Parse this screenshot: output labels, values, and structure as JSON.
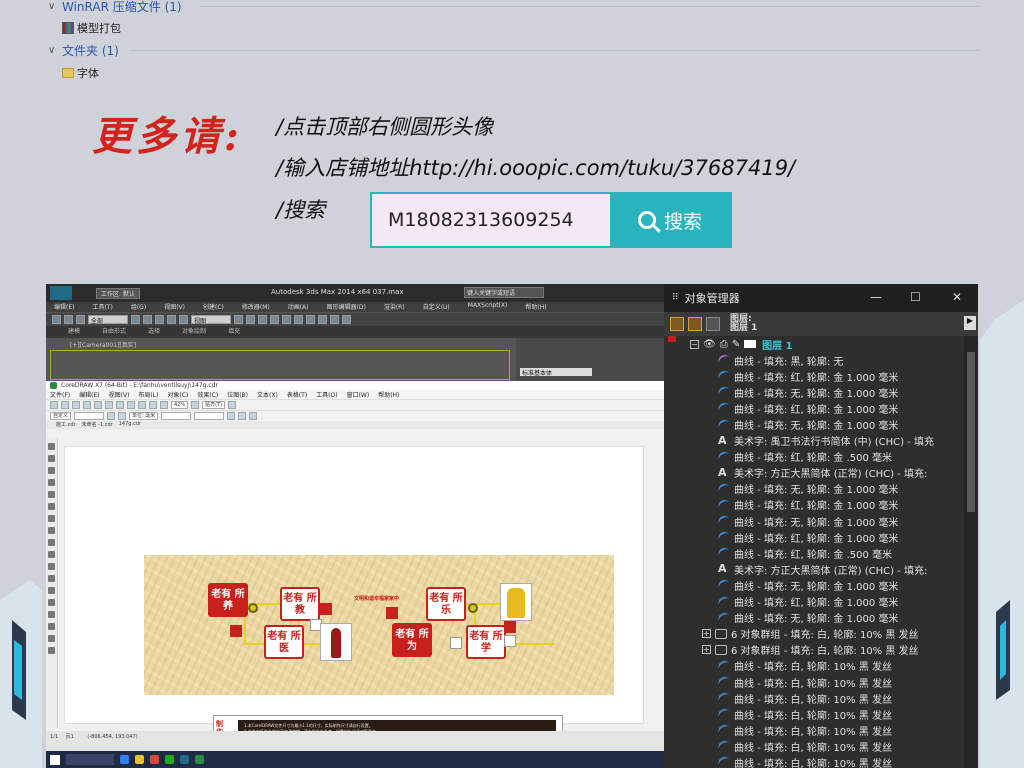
{
  "explorer": {
    "groups": [
      {
        "label": "WinRAR 压缩文件 (1)",
        "file": "模型打包"
      },
      {
        "label": "文件夹 (1)",
        "file": "字体"
      }
    ]
  },
  "promo": {
    "headline": "更多请:",
    "line1": "/点击顶部右侧圆形头像",
    "line2": "/输入店铺地址http://hi.ooopic.com/tuku/37687419/",
    "line3": "/搜索",
    "search_value": "M18082313609254",
    "search_button": "搜索"
  },
  "max": {
    "workspace": "工作区: 默认",
    "title": "Autodesk 3ds Max  2014 x64        037.max",
    "help_placeholder": "键入关键字或短语",
    "menu": [
      "编辑(E)",
      "工具(T)",
      "组(G)",
      "视图(V)",
      "创建(C)",
      "修改器(M)",
      "动画(A)",
      "图形编辑器(D)",
      "渲染(R)",
      "自定义(U)",
      "MAXScript(X)",
      "帮助(H)"
    ],
    "selection": "全部",
    "view": "视图",
    "tabs": [
      "建模",
      "自由形式",
      "选择",
      "对象绘制",
      "填充"
    ],
    "viewport_label": "[+][Camera001][真实]",
    "panel_field": "标准基本体"
  },
  "corel": {
    "title": "CoreDRAW X7 (64-Bit) - E:\\fanhu\\ventilsuyj\\147g.cdr",
    "menu": [
      "文件(F)",
      "编辑(E)",
      "视图(V)",
      "布局(L)",
      "对象(C)",
      "效果(C)",
      "位图(B)",
      "文本(X)",
      "表格(T)",
      "工具(O)",
      "窗口(W)",
      "帮助(H)"
    ],
    "zoom": "42%",
    "snap": "贴齐(T)",
    "unit": "单位: 毫米",
    "paper": "自定义",
    "doc_tabs": [
      "施工.cdr",
      "未命名 -1.cdr",
      "147g.cdr"
    ],
    "status": "(-806.454, 193.047)",
    "page": "1/1",
    "page_label": "页1"
  },
  "design": {
    "center_title": "文明和谐幸福家家中",
    "tiles": {
      "t1": "老有 所养",
      "t2": "老有 所教",
      "t3": "老有 所医",
      "t4": "老有 所乐",
      "t5": "老有 所为",
      "t6": "老有 所学"
    },
    "note_label": "制作说明",
    "note_lines": [
      "1.本CorelDRAW文件尺寸为最小1:1的尺寸，实际制作尺寸请自行设置。",
      "2.文件中所含文字均可修改编辑，请在制作中参考，如素材有误请对照原文。",
      "3.本文件为矢量格式文件，请确认使用矢量软件打开编辑并输出。",
      "4.制作材料请自行选择（请与客户确认）。"
    ]
  },
  "object_manager": {
    "title": "对象管理器",
    "layers_header": "图层:",
    "layer_current": "图层 1",
    "layer_row": "图层 1",
    "rows": [
      {
        "type": "curve-purple",
        "text": "曲线 - 填充: 黑, 轮廓: 无"
      },
      {
        "type": "curve",
        "text": "曲线 - 填充: 红, 轮廓: 金  1.000 毫米"
      },
      {
        "type": "curve",
        "text": "曲线 - 填充: 无, 轮廓: 金  1.000 毫米"
      },
      {
        "type": "curve",
        "text": "曲线 - 填充: 红, 轮廓: 金  1.000 毫米"
      },
      {
        "type": "curve",
        "text": "曲线 - 填充: 无, 轮廓: 金  1.000 毫米"
      },
      {
        "type": "text",
        "text": "美术字:  禹卫书法行书简体 (中) (CHC) - 填充"
      },
      {
        "type": "curve",
        "text": "曲线 - 填充: 红, 轮廓: 金  .500 毫米"
      },
      {
        "type": "text",
        "text": "美术字:  方正大黑简体 (正常) (CHC) - 填充:"
      },
      {
        "type": "curve",
        "text": "曲线 - 填充: 无, 轮廓: 金  1.000 毫米"
      },
      {
        "type": "curve",
        "text": "曲线 - 填充: 红, 轮廓: 金  1.000 毫米"
      },
      {
        "type": "curve",
        "text": "曲线 - 填充: 无, 轮廓: 金  1.000 毫米"
      },
      {
        "type": "curve",
        "text": "曲线 - 填充: 红, 轮廓: 金  1.000 毫米"
      },
      {
        "type": "curve",
        "text": "曲线 - 填充: 红, 轮廓: 金  .500 毫米"
      },
      {
        "type": "text",
        "text": "美术字:  方正大黑简体 (正常) (CHC) - 填充:"
      },
      {
        "type": "curve",
        "text": "曲线 - 填充: 无, 轮廓: 金  1.000 毫米"
      },
      {
        "type": "curve",
        "text": "曲线 - 填充: 红, 轮廓: 金  1.000 毫米"
      },
      {
        "type": "curve",
        "text": "曲线 - 填充: 无, 轮廓: 金  1.000 毫米"
      },
      {
        "type": "group",
        "text": "6 对象群组 - 填充: 白, 轮廓: 10% 黑 发丝"
      },
      {
        "type": "group",
        "text": "6 对象群组 - 填充: 白, 轮廓: 10% 黑 发丝"
      },
      {
        "type": "curve",
        "text": "曲线 - 填充: 白, 轮廓: 10% 黑 发丝"
      },
      {
        "type": "curve",
        "text": "曲线 - 填充: 白, 轮廓: 10% 黑 发丝"
      },
      {
        "type": "curve",
        "text": "曲线 - 填充: 白, 轮廓: 10% 黑 发丝"
      },
      {
        "type": "curve",
        "text": "曲线 - 填充: 白, 轮廓: 10% 黑 发丝"
      },
      {
        "type": "curve",
        "text": "曲线 - 填充: 白, 轮廓: 10% 黑 发丝"
      },
      {
        "type": "curve",
        "text": "曲线 - 填充: 白, 轮廓: 10% 黑 发丝"
      },
      {
        "type": "curve",
        "text": "曲线 - 填充: 白, 轮廓: 10% 黑 发丝"
      },
      {
        "type": "curve",
        "text": "曲线 - 填充: 白, 轮廓: 10% 黑 发丝"
      }
    ]
  }
}
